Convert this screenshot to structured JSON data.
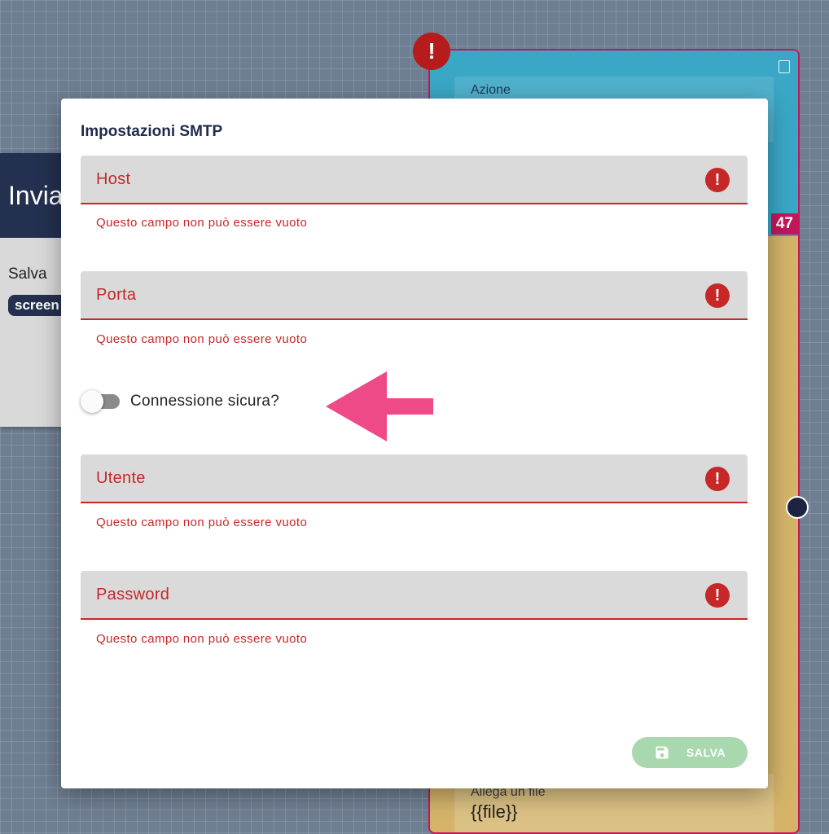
{
  "canvas": {
    "left_node": {
      "title": "Invia",
      "save_label": "Salva",
      "chip_label": "screen"
    },
    "right_node": {
      "field_label": "Azione",
      "badge": "47",
      "attach_label": "Allega un file",
      "attach_value": "{{file}}"
    },
    "node_error_glyph": "!"
  },
  "modal": {
    "title": "Impostazioni SMTP",
    "fields": [
      {
        "label": "Host",
        "error": "Questo campo non può essere vuoto"
      },
      {
        "label": "Porta",
        "error": "Questo campo non può essere vuoto"
      },
      {
        "label": "Utente",
        "error": "Questo campo non può essere vuoto"
      },
      {
        "label": "Password",
        "error": "Questo campo non può essere vuoto"
      }
    ],
    "error_glyph": "!",
    "secure_toggle": {
      "label": "Connessione sicura?",
      "checked": false
    },
    "save_button": {
      "label": "SALVA",
      "icon": "floppy-disk-icon"
    }
  },
  "colors": {
    "error": "#c62828",
    "title": "#1f2b4d",
    "save_button": "#a9d8ae",
    "arrow": "#ee4a87"
  }
}
